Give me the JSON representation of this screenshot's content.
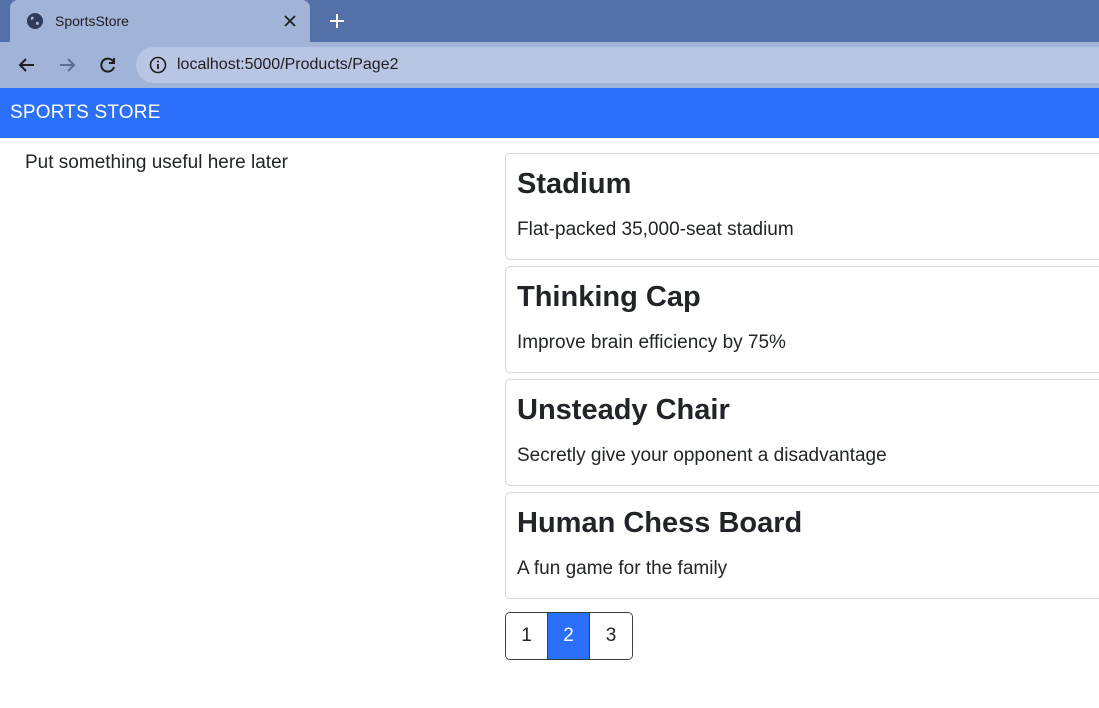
{
  "browser": {
    "tab_title": "SportsStore",
    "url": "localhost:5000/Products/Page2"
  },
  "site": {
    "brand": "SPORTS STORE",
    "sidebar_text": "Put something useful here later"
  },
  "products": [
    {
      "name": "Stadium",
      "description": "Flat-packed 35,000-seat stadium"
    },
    {
      "name": "Thinking Cap",
      "description": "Improve brain efficiency by 75%"
    },
    {
      "name": "Unsteady Chair",
      "description": "Secretly give your opponent a disadvantage"
    },
    {
      "name": "Human Chess Board",
      "description": "A fun game for the family"
    }
  ],
  "pagination": {
    "pages": [
      "1",
      "2",
      "3"
    ],
    "current": "2"
  },
  "colors": {
    "brand_bar": "#2b70fb",
    "active_page": "#2b70fb"
  }
}
